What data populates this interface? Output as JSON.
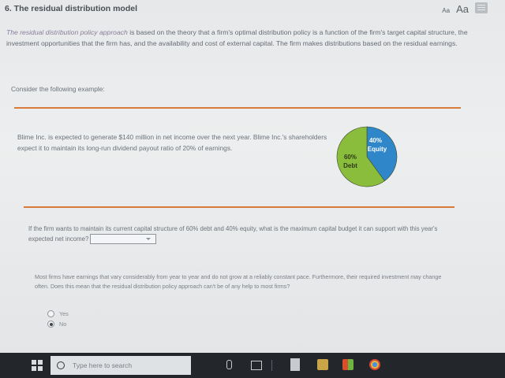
{
  "header": {
    "title": "6. The residual distribution model",
    "font_small": "Aa",
    "font_large": "Aa"
  },
  "intro": {
    "italic": "The residual distribution policy approach",
    "text": " is based on the theory that a firm's optimal distribution policy is a function of the firm's target capital structure, the investment opportunities that the firm has, and the availability and cost of external capital. The firm makes distributions based on the residual earnings."
  },
  "consider": "Consider the following example:",
  "example": {
    "text": "Blime Inc. is expected to generate $140 million in net income over the next year. Blime Inc.'s shareholders expect it to maintain its long-run dividend payout ratio of 20% of earnings."
  },
  "chart_data": {
    "type": "pie",
    "slices": [
      {
        "label": "Equity",
        "value": 40,
        "value_label": "40%",
        "color": "#2f86c9"
      },
      {
        "label": "Debt",
        "value": 60,
        "value_label": "60%",
        "color": "#8bbd3c"
      }
    ]
  },
  "question1": {
    "text": "If the firm wants to maintain its current capital structure of 60% debt and 40% equity, what is the maximum capital budget it can support with this year's expected net income?",
    "dropdown_value": ""
  },
  "question2": {
    "text": "Most firms have earnings that vary considerably from year to year and do not grow at a reliably constant pace. Furthermore, their required investment may change often. Does this mean that the residual distribution policy approach can't be of any help to most firms?",
    "options": [
      {
        "label": "Yes",
        "selected": false
      },
      {
        "label": "No",
        "selected": true
      }
    ]
  },
  "taskbar": {
    "search_placeholder": "Type here to search"
  }
}
